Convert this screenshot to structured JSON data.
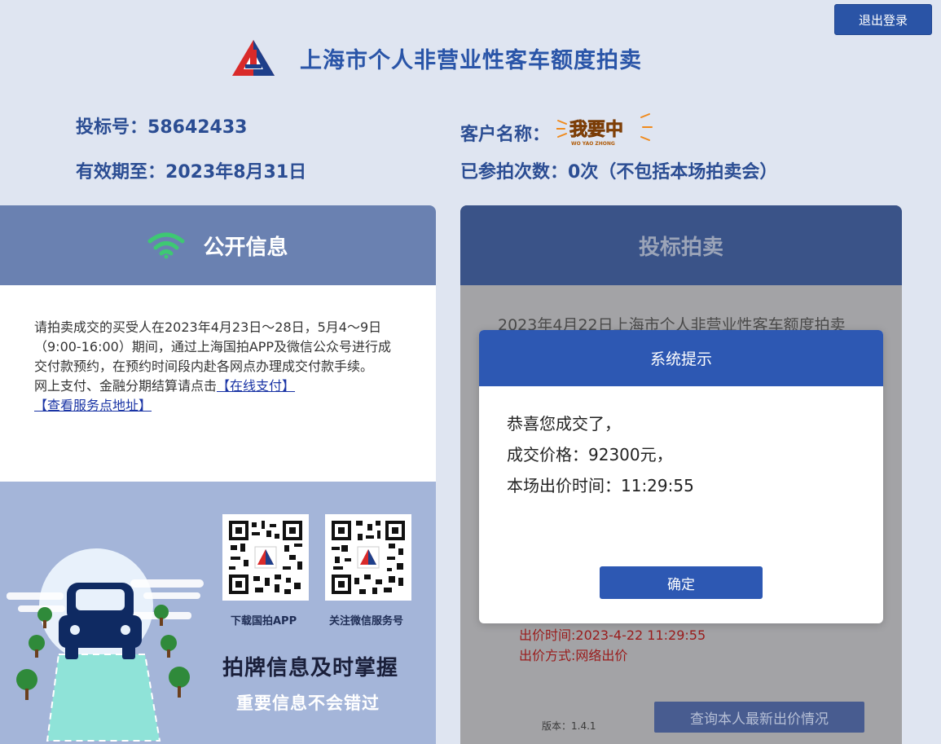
{
  "header": {
    "logout_label": "退出登录",
    "app_title": "上海市个人非营业性客车额度拍卖"
  },
  "user_info": {
    "bid_number_label": "投标号：",
    "bid_number": "58642433",
    "valid_until_label": "有效期至：",
    "valid_until": "2023年8月31日",
    "customer_name_label": "客户名称：",
    "customer_logo_text": "我要中",
    "customer_logo_pinyin": "WO YAO ZHONG",
    "participation_label": "已参拍次数：",
    "participation_value": "0次（不包括本场拍卖会）"
  },
  "public_info": {
    "title": "公开信息",
    "notice_text": "请拍卖成交的买受人在2023年4月23日～28日，5月4～9日（9:00-16:00）期间，通过上海国拍APP及微信公众号进行成交付款预约，在预约时间段内赴各网点办理成交付款手续。",
    "online_pay_prefix": "网上支付、金融分期结算请点击",
    "online_pay_link": "【在线支付】",
    "service_address_link": "【查看服务点地址】"
  },
  "promo": {
    "qr_app_caption": "下载国拍APP",
    "qr_wechat_caption": "关注微信服务号",
    "main_slogan": "拍牌信息及时掌握",
    "sub_slogan": "重要信息不会错过"
  },
  "auction": {
    "title": "投标拍卖",
    "auction_line": "2023年4月22日上海市个人非营业性客车额度拍卖",
    "bid_time": "出价时间:2023-4-22 11:29:55",
    "bid_method": "出价方式:网络出价",
    "version": "版本：1.4.1",
    "query_button": "查询本人最新出价情况"
  },
  "modal": {
    "title": "系统提示",
    "line1": "恭喜您成交了，",
    "line2": "成交价格：92300元，",
    "line3": "本场出价时间：11:29:55",
    "ok_button": "确定"
  },
  "colors": {
    "brand_blue": "#2a55a8",
    "modal_blue": "#2d58b3",
    "left_header": "#6a81b1",
    "right_header": "#3a5388",
    "wifi_green": "#3ec873",
    "promo_bg": "#a4b5d9"
  }
}
